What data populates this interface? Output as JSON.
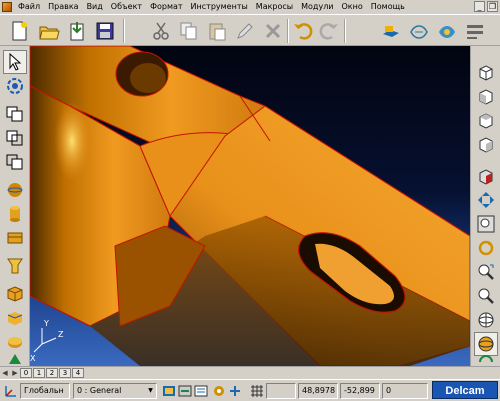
{
  "menubar": {
    "items": [
      {
        "label": "Файл"
      },
      {
        "label": "Правка"
      },
      {
        "label": "Вид"
      },
      {
        "label": "Объект"
      },
      {
        "label": "Формат"
      },
      {
        "label": "Инструменты"
      },
      {
        "label": "Макросы"
      },
      {
        "label": "Модули"
      },
      {
        "label": "Окно"
      },
      {
        "label": "Помощь"
      }
    ],
    "window_controls": {
      "minimize": "_",
      "restore": "❐"
    }
  },
  "toolbar": {
    "icons": [
      "new-file-icon",
      "open-file-icon",
      "import-icon",
      "save-icon",
      "cut-icon",
      "copy-icon",
      "paste-icon",
      "edit-icon",
      "delete-icon",
      "undo-icon",
      "redo-icon",
      "properties-icon",
      "wireframe-icon",
      "shading-icon",
      "settings-icon"
    ]
  },
  "left_toolbar": {
    "icons": [
      "select-arrow-icon",
      "transform-icon",
      "box-union-icon",
      "box-subtract-icon",
      "box-intersect-icon",
      "sphere-icon",
      "cylinder-icon",
      "cone-icon",
      "extrude-icon",
      "revolve-icon",
      "blend-icon",
      "shell-icon",
      "tool-icon",
      "solid-icon"
    ]
  },
  "right_toolbar": {
    "icons": [
      "view-iso-icon",
      "view-front-icon",
      "view-top-icon",
      "view-side-icon",
      "view-cube-icon",
      "zoom-fit-icon",
      "zoom-window-icon",
      "rotate-icon",
      "pan-icon",
      "zoom-icon",
      "sphere-view-icon",
      "shaded-sphere-icon",
      "refresh-icon"
    ]
  },
  "viewport": {
    "axis_labels": {
      "x": "X",
      "y": "Y",
      "z": "Z"
    },
    "colors": {
      "part": "#e8901a",
      "edge": "#c41400",
      "bg_top": "#020410",
      "bg_bottom": "#3b6ac0"
    }
  },
  "tabs": {
    "items": [
      {
        "label": "0"
      },
      {
        "label": "1"
      },
      {
        "label": "2"
      },
      {
        "label": "3"
      },
      {
        "label": "4"
      }
    ]
  },
  "statusbar": {
    "workplane": "Глобальн",
    "level": "0 : General",
    "coord_x": "48,8978",
    "coord_y": "-52,899",
    "coord_z": "0"
  },
  "brand": {
    "label": "Delcam"
  }
}
